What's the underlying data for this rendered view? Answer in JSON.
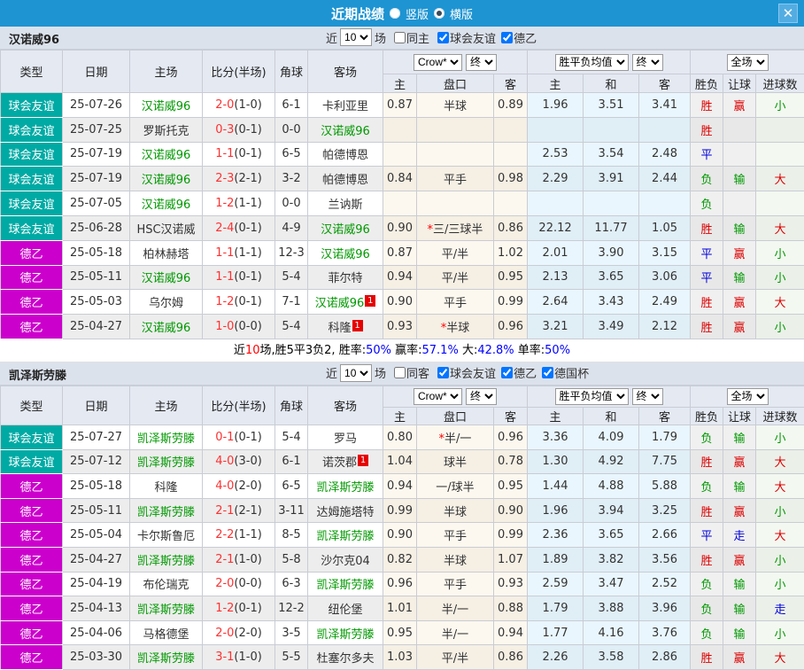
{
  "titlebar": {
    "title": "近期战绩",
    "radios": [
      {
        "label": "竖版",
        "selected": false
      },
      {
        "label": "横版",
        "selected": true
      }
    ],
    "close_label": "✕"
  },
  "colors": {
    "accent_blue": "#1e94d2",
    "type_friendly_teal": "#00aaa4",
    "type_league_magenta": "#cc00cc",
    "team_highlight_green": "#009900",
    "score_red": "#ff3030",
    "win_red": "#dd0000",
    "draw_blue": "#0000dd",
    "lose_green": "#009900"
  },
  "sections": [
    {
      "team": "汉诺威96",
      "controls": {
        "near": "近",
        "count": "10",
        "games": "场",
        "same": {
          "label": "同主",
          "checked": false
        },
        "filters": [
          {
            "label": "球会友谊",
            "checked": true
          },
          {
            "label": "德乙",
            "checked": true
          }
        ]
      },
      "table": {
        "main_headers": [
          "类型",
          "日期",
          "主场",
          "比分(半场)",
          "角球",
          "客场"
        ],
        "odds_select": "Crow*",
        "odds_final": "终",
        "avg_select": "胜平负均值",
        "avg_final": "终",
        "full_select": "全场",
        "sub_headers": [
          "主",
          "盘口",
          "客",
          "主",
          "和",
          "客",
          "胜负",
          "让球",
          "进球数"
        ],
        "rows": [
          {
            "type": "球会友谊",
            "type_class": "friendly",
            "date": "25-07-26",
            "home": "汉诺威96",
            "home_hl": true,
            "home_badge": "",
            "score": "2-0",
            "half": "(1-0)",
            "corner": "6-1",
            "away": "卡利亚里",
            "away_hl": false,
            "away_badge": "",
            "o_home": "0.87",
            "handicap": "半球",
            "handicap_star": false,
            "o_away": "0.89",
            "avg_home": "1.96",
            "avg_draw": "3.51",
            "avg_away": "3.41",
            "res": [
              "胜",
              "赢",
              "小"
            ],
            "res_c": [
              "r",
              "r",
              "g"
            ]
          },
          {
            "type": "球会友谊",
            "type_class": "friendly",
            "date": "25-07-25",
            "home": "罗斯托克",
            "home_hl": false,
            "home_badge": "",
            "score": "0-3",
            "half": "(0-1)",
            "corner": "0-0",
            "away": "汉诺威96",
            "away_hl": true,
            "away_badge": "",
            "o_home": "",
            "handicap": "",
            "handicap_star": false,
            "o_away": "",
            "avg_home": "",
            "avg_draw": "",
            "avg_away": "",
            "res": [
              "胜",
              "",
              ""
            ],
            "res_c": [
              "r",
              "",
              ""
            ]
          },
          {
            "type": "球会友谊",
            "type_class": "friendly",
            "date": "25-07-19",
            "home": "汉诺威96",
            "home_hl": true,
            "home_badge": "",
            "score": "1-1",
            "half": "(0-1)",
            "corner": "6-5",
            "away": "帕德博恩",
            "away_hl": false,
            "away_badge": "",
            "o_home": "",
            "handicap": "",
            "handicap_star": false,
            "o_away": "",
            "avg_home": "2.53",
            "avg_draw": "3.54",
            "avg_away": "2.48",
            "res": [
              "平",
              "",
              ""
            ],
            "res_c": [
              "b",
              "",
              ""
            ]
          },
          {
            "type": "球会友谊",
            "type_class": "friendly",
            "date": "25-07-19",
            "home": "汉诺威96",
            "home_hl": true,
            "home_badge": "",
            "score": "2-3",
            "half": "(2-1)",
            "corner": "3-2",
            "away": "帕德博恩",
            "away_hl": false,
            "away_badge": "",
            "o_home": "0.84",
            "handicap": "平手",
            "handicap_star": false,
            "o_away": "0.98",
            "avg_home": "2.29",
            "avg_draw": "3.91",
            "avg_away": "2.44",
            "res": [
              "负",
              "输",
              "大"
            ],
            "res_c": [
              "g",
              "g",
              "r"
            ]
          },
          {
            "type": "球会友谊",
            "type_class": "friendly",
            "date": "25-07-05",
            "home": "汉诺威96",
            "home_hl": true,
            "home_badge": "",
            "score": "1-2",
            "half": "(1-1)",
            "corner": "0-0",
            "away": "兰讷斯",
            "away_hl": false,
            "away_badge": "",
            "o_home": "",
            "handicap": "",
            "handicap_star": false,
            "o_away": "",
            "avg_home": "",
            "avg_draw": "",
            "avg_away": "",
            "res": [
              "负",
              "",
              ""
            ],
            "res_c": [
              "g",
              "",
              ""
            ]
          },
          {
            "type": "球会友谊",
            "type_class": "friendly",
            "date": "25-06-28",
            "home": "HSC汉诺威",
            "home_hl": false,
            "home_badge": "",
            "score": "2-4",
            "half": "(0-1)",
            "corner": "4-9",
            "away": "汉诺威96",
            "away_hl": true,
            "away_badge": "",
            "o_home": "0.90",
            "handicap": "三/三球半",
            "handicap_star": true,
            "o_away": "0.86",
            "avg_home": "22.12",
            "avg_draw": "11.77",
            "avg_away": "1.05",
            "res": [
              "胜",
              "输",
              "大"
            ],
            "res_c": [
              "r",
              "g",
              "r"
            ]
          },
          {
            "type": "德乙",
            "type_class": "league",
            "date": "25-05-18",
            "home": "柏林赫塔",
            "home_hl": false,
            "home_badge": "",
            "score": "1-1",
            "half": "(1-1)",
            "corner": "12-3",
            "away": "汉诺威96",
            "away_hl": true,
            "away_badge": "",
            "o_home": "0.87",
            "handicap": "平/半",
            "handicap_star": false,
            "o_away": "1.02",
            "avg_home": "2.01",
            "avg_draw": "3.90",
            "avg_away": "3.15",
            "res": [
              "平",
              "赢",
              "小"
            ],
            "res_c": [
              "b",
              "r",
              "g"
            ]
          },
          {
            "type": "德乙",
            "type_class": "league",
            "date": "25-05-11",
            "home": "汉诺威96",
            "home_hl": true,
            "home_badge": "",
            "score": "1-1",
            "half": "(0-1)",
            "corner": "5-4",
            "away": "菲尔特",
            "away_hl": false,
            "away_badge": "",
            "o_home": "0.94",
            "handicap": "平/半",
            "handicap_star": false,
            "o_away": "0.95",
            "avg_home": "2.13",
            "avg_draw": "3.65",
            "avg_away": "3.06",
            "res": [
              "平",
              "输",
              "小"
            ],
            "res_c": [
              "b",
              "g",
              "g"
            ]
          },
          {
            "type": "德乙",
            "type_class": "league",
            "date": "25-05-03",
            "home": "乌尔姆",
            "home_hl": false,
            "home_badge": "",
            "score": "1-2",
            "half": "(0-1)",
            "corner": "7-1",
            "away": "汉诺威96",
            "away_hl": true,
            "away_badge": "1",
            "o_home": "0.90",
            "handicap": "平手",
            "handicap_star": false,
            "o_away": "0.99",
            "avg_home": "2.64",
            "avg_draw": "3.43",
            "avg_away": "2.49",
            "res": [
              "胜",
              "赢",
              "大"
            ],
            "res_c": [
              "r",
              "r",
              "r"
            ]
          },
          {
            "type": "德乙",
            "type_class": "league",
            "date": "25-04-27",
            "home": "汉诺威96",
            "home_hl": true,
            "home_badge": "",
            "score": "1-0",
            "half": "(0-0)",
            "corner": "5-4",
            "away": "科隆",
            "away_hl": false,
            "away_badge": "1",
            "o_home": "0.93",
            "handicap": "半球",
            "handicap_star": true,
            "o_away": "0.96",
            "avg_home": "3.21",
            "avg_draw": "3.49",
            "avg_away": "2.12",
            "res": [
              "胜",
              "赢",
              "小"
            ],
            "res_c": [
              "r",
              "r",
              "g"
            ]
          }
        ]
      },
      "summary": [
        {
          "text": "近",
          "c": "sk"
        },
        {
          "text": "10",
          "c": "sr"
        },
        {
          "text": "场,胜5平3负2, 胜率:",
          "c": "sk"
        },
        {
          "text": "50%",
          "c": "sb"
        },
        {
          "text": " 赢率:",
          "c": "sk"
        },
        {
          "text": "57.1%",
          "c": "sb"
        },
        {
          "text": " 大:",
          "c": "sk"
        },
        {
          "text": "42.8%",
          "c": "sb"
        },
        {
          "text": " 单率:",
          "c": "sk"
        },
        {
          "text": "50%",
          "c": "sb"
        }
      ]
    },
    {
      "team": "凯泽斯劳滕",
      "controls": {
        "near": "近",
        "count": "10",
        "games": "场",
        "same": {
          "label": "同客",
          "checked": false
        },
        "filters": [
          {
            "label": "球会友谊",
            "checked": true
          },
          {
            "label": "德乙",
            "checked": true
          },
          {
            "label": "德国杯",
            "checked": true
          }
        ]
      },
      "table": {
        "main_headers": [
          "类型",
          "日期",
          "主场",
          "比分(半场)",
          "角球",
          "客场"
        ],
        "odds_select": "Crow*",
        "odds_final": "终",
        "avg_select": "胜平负均值",
        "avg_final": "终",
        "full_select": "全场",
        "sub_headers": [
          "主",
          "盘口",
          "客",
          "主",
          "和",
          "客",
          "胜负",
          "让球",
          "进球数"
        ],
        "rows": [
          {
            "type": "球会友谊",
            "type_class": "friendly",
            "date": "25-07-27",
            "home": "凯泽斯劳滕",
            "home_hl": true,
            "home_badge": "",
            "score": "0-1",
            "half": "(0-1)",
            "corner": "5-4",
            "away": "罗马",
            "away_hl": false,
            "away_badge": "",
            "o_home": "0.80",
            "handicap": "半/一",
            "handicap_star": true,
            "o_away": "0.96",
            "avg_home": "3.36",
            "avg_draw": "4.09",
            "avg_away": "1.79",
            "res": [
              "负",
              "输",
              "小"
            ],
            "res_c": [
              "g",
              "g",
              "g"
            ]
          },
          {
            "type": "球会友谊",
            "type_class": "friendly",
            "date": "25-07-12",
            "home": "凯泽斯劳滕",
            "home_hl": true,
            "home_badge": "",
            "score": "4-0",
            "half": "(3-0)",
            "corner": "6-1",
            "away": "诺茨郡",
            "away_hl": false,
            "away_badge": "1",
            "o_home": "1.04",
            "handicap": "球半",
            "handicap_star": false,
            "o_away": "0.78",
            "avg_home": "1.30",
            "avg_draw": "4.92",
            "avg_away": "7.75",
            "res": [
              "胜",
              "赢",
              "大"
            ],
            "res_c": [
              "r",
              "r",
              "r"
            ]
          },
          {
            "type": "德乙",
            "type_class": "league",
            "date": "25-05-18",
            "home": "科隆",
            "home_hl": false,
            "home_badge": "",
            "score": "4-0",
            "half": "(2-0)",
            "corner": "6-5",
            "away": "凯泽斯劳滕",
            "away_hl": true,
            "away_badge": "",
            "o_home": "0.94",
            "handicap": "一/球半",
            "handicap_star": false,
            "o_away": "0.95",
            "avg_home": "1.44",
            "avg_draw": "4.88",
            "avg_away": "5.88",
            "res": [
              "负",
              "输",
              "大"
            ],
            "res_c": [
              "g",
              "g",
              "r"
            ]
          },
          {
            "type": "德乙",
            "type_class": "league",
            "date": "25-05-11",
            "home": "凯泽斯劳滕",
            "home_hl": true,
            "home_badge": "",
            "score": "2-1",
            "half": "(2-1)",
            "corner": "3-11",
            "away": "达姆施塔特",
            "away_hl": false,
            "away_badge": "",
            "o_home": "0.99",
            "handicap": "半球",
            "handicap_star": false,
            "o_away": "0.90",
            "avg_home": "1.96",
            "avg_draw": "3.94",
            "avg_away": "3.25",
            "res": [
              "胜",
              "赢",
              "小"
            ],
            "res_c": [
              "r",
              "r",
              "g"
            ]
          },
          {
            "type": "德乙",
            "type_class": "league",
            "date": "25-05-04",
            "home": "卡尔斯鲁厄",
            "home_hl": false,
            "home_badge": "",
            "score": "2-2",
            "half": "(1-1)",
            "corner": "8-5",
            "away": "凯泽斯劳滕",
            "away_hl": true,
            "away_badge": "",
            "o_home": "0.90",
            "handicap": "平手",
            "handicap_star": false,
            "o_away": "0.99",
            "avg_home": "2.36",
            "avg_draw": "3.65",
            "avg_away": "2.66",
            "res": [
              "平",
              "走",
              "大"
            ],
            "res_c": [
              "b",
              "b",
              "r"
            ]
          },
          {
            "type": "德乙",
            "type_class": "league",
            "date": "25-04-27",
            "home": "凯泽斯劳滕",
            "home_hl": true,
            "home_badge": "",
            "score": "2-1",
            "half": "(1-0)",
            "corner": "5-8",
            "away": "沙尔克04",
            "away_hl": false,
            "away_badge": "",
            "o_home": "0.82",
            "handicap": "半球",
            "handicap_star": false,
            "o_away": "1.07",
            "avg_home": "1.89",
            "avg_draw": "3.82",
            "avg_away": "3.56",
            "res": [
              "胜",
              "赢",
              "小"
            ],
            "res_c": [
              "r",
              "r",
              "g"
            ]
          },
          {
            "type": "德乙",
            "type_class": "league",
            "date": "25-04-19",
            "home": "布伦瑞克",
            "home_hl": false,
            "home_badge": "",
            "score": "2-0",
            "half": "(0-0)",
            "corner": "6-3",
            "away": "凯泽斯劳滕",
            "away_hl": true,
            "away_badge": "",
            "o_home": "0.96",
            "handicap": "平手",
            "handicap_star": false,
            "o_away": "0.93",
            "avg_home": "2.59",
            "avg_draw": "3.47",
            "avg_away": "2.52",
            "res": [
              "负",
              "输",
              "小"
            ],
            "res_c": [
              "g",
              "g",
              "g"
            ]
          },
          {
            "type": "德乙",
            "type_class": "league",
            "date": "25-04-13",
            "home": "凯泽斯劳滕",
            "home_hl": true,
            "home_badge": "",
            "score": "1-2",
            "half": "(0-1)",
            "corner": "12-2",
            "away": "纽伦堡",
            "away_hl": false,
            "away_badge": "",
            "o_home": "1.01",
            "handicap": "半/一",
            "handicap_star": false,
            "o_away": "0.88",
            "avg_home": "1.79",
            "avg_draw": "3.88",
            "avg_away": "3.96",
            "res": [
              "负",
              "输",
              "走"
            ],
            "res_c": [
              "g",
              "g",
              "b"
            ]
          },
          {
            "type": "德乙",
            "type_class": "league",
            "date": "25-04-06",
            "home": "马格德堡",
            "home_hl": false,
            "home_badge": "",
            "score": "2-0",
            "half": "(2-0)",
            "corner": "3-5",
            "away": "凯泽斯劳滕",
            "away_hl": true,
            "away_badge": "",
            "o_home": "0.95",
            "handicap": "半/一",
            "handicap_star": false,
            "o_away": "0.94",
            "avg_home": "1.77",
            "avg_draw": "4.16",
            "avg_away": "3.76",
            "res": [
              "负",
              "输",
              "小"
            ],
            "res_c": [
              "g",
              "g",
              "g"
            ]
          },
          {
            "type": "德乙",
            "type_class": "league",
            "date": "25-03-30",
            "home": "凯泽斯劳滕",
            "home_hl": true,
            "home_badge": "",
            "score": "3-1",
            "half": "(1-0)",
            "corner": "5-5",
            "away": "杜塞尔多夫",
            "away_hl": false,
            "away_badge": "",
            "o_home": "1.03",
            "handicap": "平/半",
            "handicap_star": false,
            "o_away": "0.86",
            "avg_home": "2.26",
            "avg_draw": "3.58",
            "avg_away": "2.86",
            "res": [
              "胜",
              "赢",
              "大"
            ],
            "res_c": [
              "r",
              "r",
              "r"
            ]
          }
        ]
      },
      "summary": null
    }
  ]
}
